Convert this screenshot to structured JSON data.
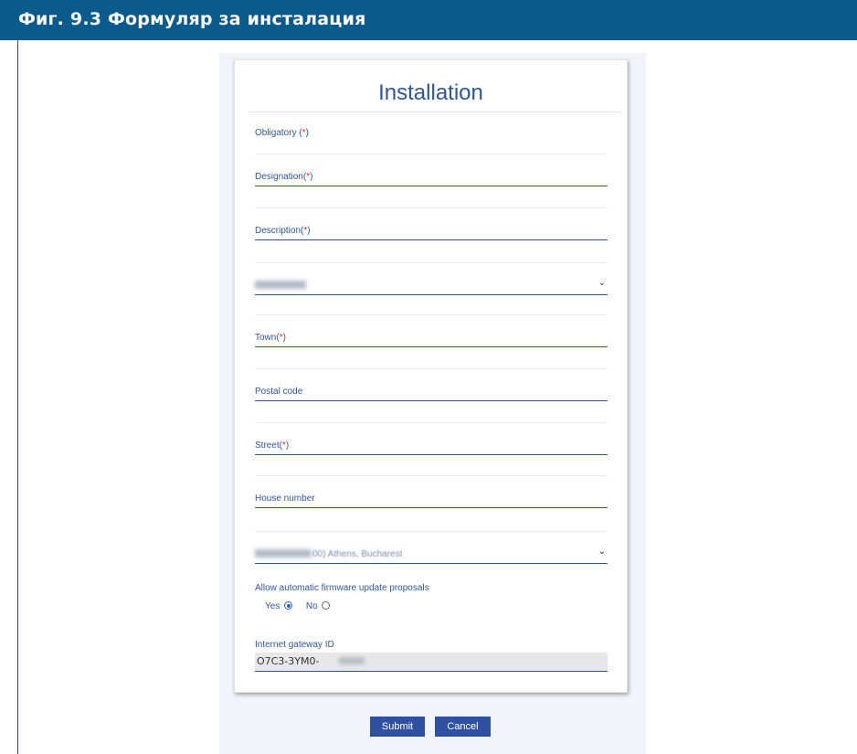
{
  "figure": {
    "caption": "Фиг. 9.3 Формуляр за инсталация"
  },
  "form": {
    "title": "Installation",
    "obligatory_text": "Obligatory (",
    "obligatory_mark": "*",
    "obligatory_close": ")",
    "fields": {
      "designation": {
        "label": "Designation(",
        "mark": "*",
        "close": ")"
      },
      "description": {
        "label": "Description(",
        "mark": "*",
        "close": ")"
      },
      "country_select": {
        "value": ""
      },
      "town": {
        "label": "Town(",
        "mark": "*",
        "close": ")"
      },
      "postal_code": {
        "label": "Postal code"
      },
      "street": {
        "label": "Street(",
        "mark": "*",
        "close": ")"
      },
      "house_number": {
        "label": "House number"
      },
      "timezone_select": {
        "value_visible": "00) Athens, Bucharest"
      }
    },
    "firmware_update": {
      "label": "Allow automatic firmware update proposals",
      "yes_label": "Yes",
      "no_label": "No",
      "selected": "Yes"
    },
    "gateway": {
      "label": "Internet gateway ID",
      "value": "O7C3-3YM0-"
    },
    "buttons": {
      "submit": "Submit",
      "cancel": "Cancel"
    }
  },
  "colors": {
    "header_bg": "#0a5a8c",
    "accent": "#2f5597",
    "required": "#e0242c",
    "button": "#2f4fa0"
  }
}
